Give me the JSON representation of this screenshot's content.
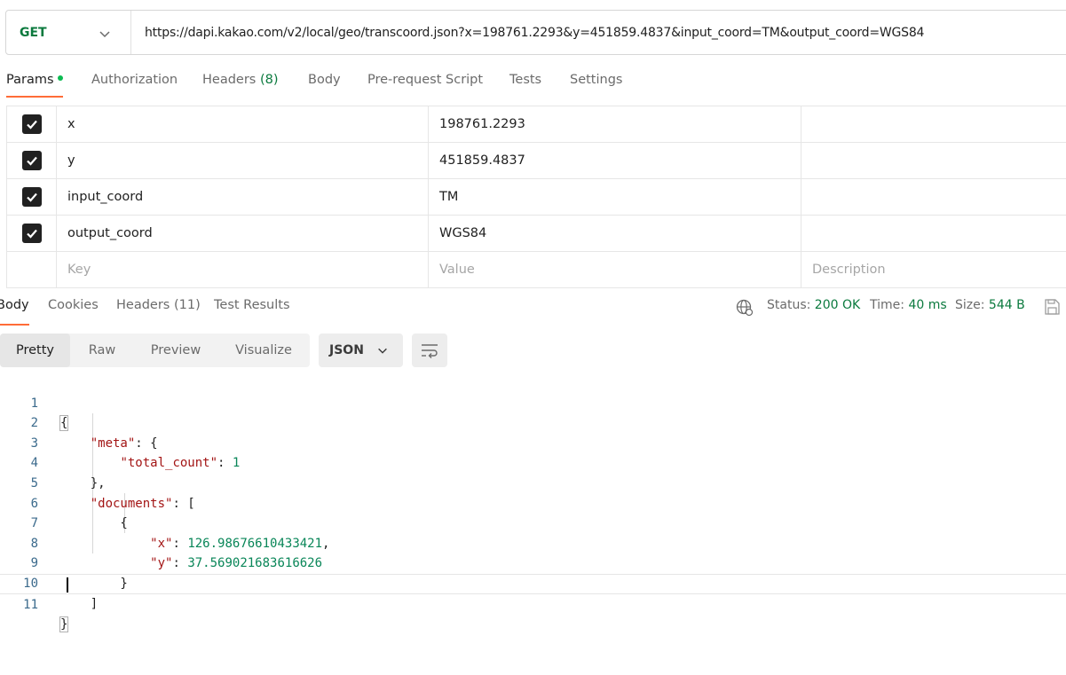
{
  "request": {
    "method": "GET",
    "url": "https://dapi.kakao.com/v2/local/geo/transcoord.json?x=198761.2293&y=451859.4837&input_coord=TM&output_coord=WGS84"
  },
  "request_tabs": {
    "params": "Params",
    "authorization": "Authorization",
    "headers": "Headers",
    "headers_count": "(8)",
    "body": "Body",
    "pre_request": "Pre-request Script",
    "tests": "Tests",
    "settings": "Settings"
  },
  "params": [
    {
      "checked": true,
      "key": "x",
      "value": "198761.2293",
      "description": ""
    },
    {
      "checked": true,
      "key": "y",
      "value": "451859.4837",
      "description": ""
    },
    {
      "checked": true,
      "key": "input_coord",
      "value": "TM",
      "description": ""
    },
    {
      "checked": true,
      "key": "output_coord",
      "value": "WGS84",
      "description": ""
    }
  ],
  "params_placeholder": {
    "key": "Key",
    "value": "Value",
    "description": "Description"
  },
  "response_tabs": {
    "body": "Body",
    "cookies": "Cookies",
    "headers": "Headers (11)",
    "test_results": "Test Results"
  },
  "status": {
    "status_label": "Status:",
    "status_value": "200 OK",
    "time_label": "Time:",
    "time_value": "40 ms",
    "size_label": "Size:",
    "size_value": "544 B"
  },
  "view_modes": {
    "pretty": "Pretty",
    "raw": "Raw",
    "preview": "Preview",
    "visualize": "Visualize"
  },
  "format": "JSON",
  "code_lines": {
    "n1": "1",
    "n2": "2",
    "n3": "3",
    "n4": "4",
    "n5": "5",
    "n6": "6",
    "n7": "7",
    "n8": "8",
    "n9": "9",
    "n10": "10",
    "n11": "11",
    "meta_key": "\"meta\"",
    "total_count_key": "\"total_count\"",
    "total_count_val": "1",
    "documents_key": "\"documents\"",
    "x_key": "\"x\"",
    "x_val": "126.98676610433421",
    "y_key": "\"y\"",
    "y_val": "37.569021683616626"
  },
  "colors": {
    "accent": "#ff6c37",
    "method_green": "#0b7a3e",
    "json_key": "#a31515",
    "json_number": "#098658"
  }
}
